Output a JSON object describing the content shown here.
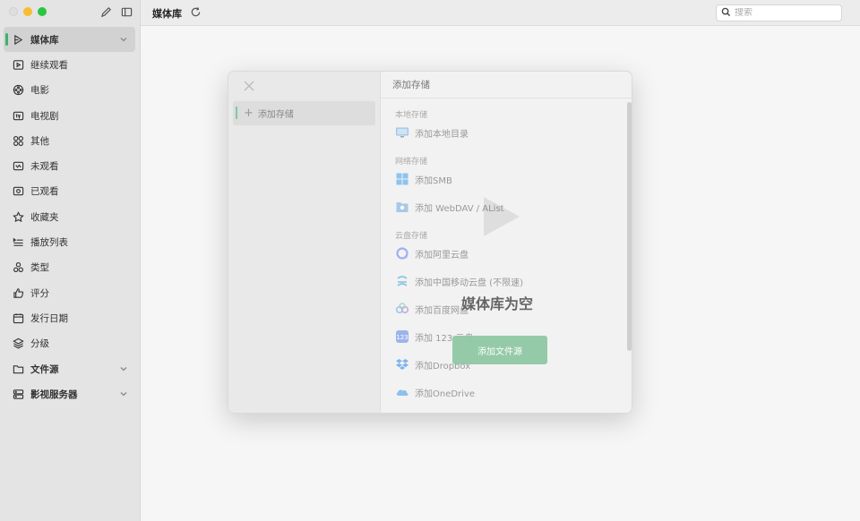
{
  "app": {
    "title": "媒体库"
  },
  "search": {
    "placeholder": "搜索"
  },
  "sidebar": {
    "items": [
      {
        "label": "媒体库",
        "icon": "media-library-icon",
        "active": true,
        "bold": true,
        "chevron": true
      },
      {
        "label": "继续观看",
        "icon": "play-square-icon"
      },
      {
        "label": "电影",
        "icon": "film-reel-icon"
      },
      {
        "label": "电视剧",
        "icon": "tv-icon"
      },
      {
        "label": "其他",
        "icon": "grid-circles-icon"
      },
      {
        "label": "未观看",
        "icon": "unwatched-icon"
      },
      {
        "label": "已观看",
        "icon": "watched-icon"
      },
      {
        "label": "收藏夹",
        "icon": "star-icon"
      },
      {
        "label": "播放列表",
        "icon": "playlist-icon"
      },
      {
        "label": "类型",
        "icon": "genre-icon"
      },
      {
        "label": "评分",
        "icon": "thumbs-up-icon"
      },
      {
        "label": "发行日期",
        "icon": "calendar-icon"
      },
      {
        "label": "分级",
        "icon": "layers-icon"
      },
      {
        "label": "文件源",
        "icon": "folder-icon",
        "bold": true,
        "chevron": true
      },
      {
        "label": "影视服务器",
        "icon": "server-icon",
        "bold": true,
        "chevron": true
      }
    ]
  },
  "main": {
    "empty_title": "媒体库为空",
    "add_source_label": "添加文件源"
  },
  "modal": {
    "side_item": "添加存储",
    "header": "添加存储",
    "sections": [
      {
        "title": "本地存储",
        "options": [
          {
            "label": "添加本地目录",
            "icon": "monitor-icon"
          }
        ]
      },
      {
        "title": "网络存储",
        "options": [
          {
            "label": "添加SMB",
            "icon": "windows-icon"
          },
          {
            "label": "添加 WebDAV / AList",
            "icon": "webdav-folder-icon"
          }
        ]
      },
      {
        "title": "云盘存储",
        "options": [
          {
            "label": "添加阿里云盘",
            "icon": "aliyun-icon"
          },
          {
            "label": "添加中国移动云盘 (不限速)",
            "icon": "china-mobile-cloud-icon"
          },
          {
            "label": "添加百度网盘",
            "icon": "baidu-netdisk-icon"
          },
          {
            "label": "添加 123 云盘",
            "icon": "123-cloud-icon"
          },
          {
            "label": "添加Dropbox",
            "icon": "dropbox-icon"
          },
          {
            "label": "添加OneDrive",
            "icon": "onedrive-icon"
          }
        ]
      }
    ]
  },
  "colors": {
    "accent": "#3fb06f",
    "button": "#8fc8a4"
  }
}
